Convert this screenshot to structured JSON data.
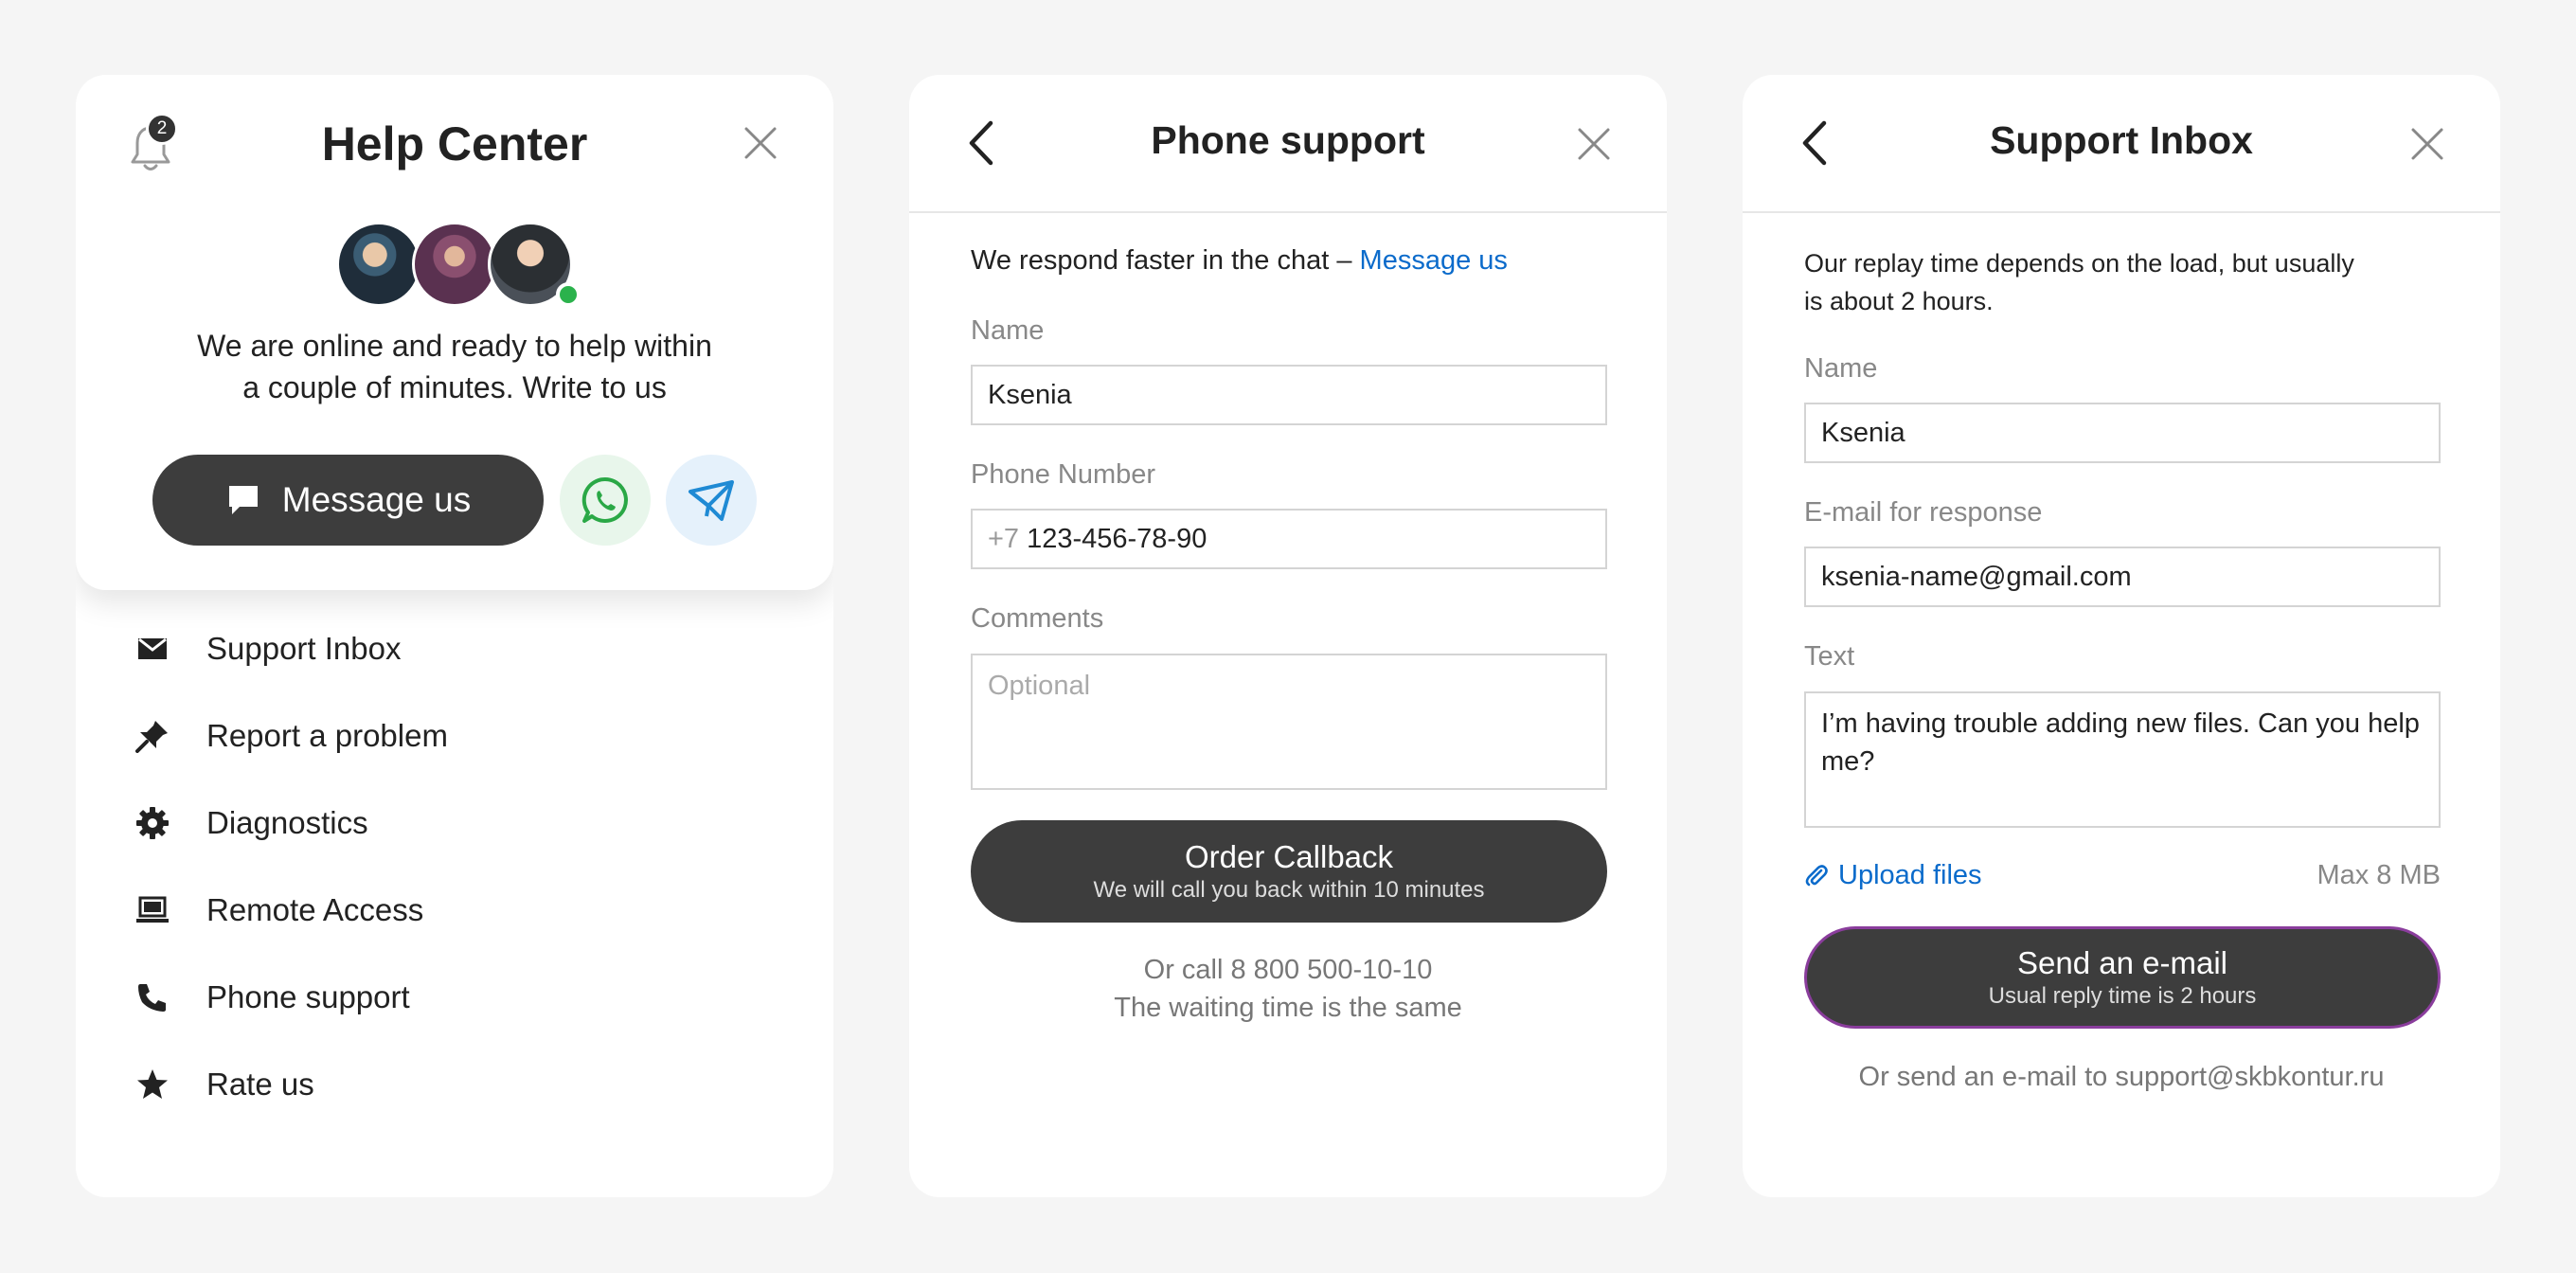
{
  "help_center": {
    "title": "Help Center",
    "notification_count": "2",
    "intro_line1": "We are online and ready to help within",
    "intro_line2": "a couple of minutes. Write to us",
    "message_button": "Message us",
    "menu": [
      {
        "label": "Support Inbox",
        "icon": "envelope-icon"
      },
      {
        "label": "Report a problem",
        "icon": "pin-icon"
      },
      {
        "label": "Diagnostics",
        "icon": "gear-icon"
      },
      {
        "label": "Remote Access",
        "icon": "laptop-icon"
      },
      {
        "label": "Phone support",
        "icon": "phone-icon"
      },
      {
        "label": "Rate us",
        "icon": "star-icon"
      }
    ]
  },
  "phone_support": {
    "title": "Phone support",
    "chat_hint": "We respond faster in the chat – ",
    "chat_link": "Message us",
    "name_label": "Name",
    "name_value": "Ksenia",
    "phone_label": "Phone Number",
    "phone_prefix": "+7",
    "phone_value": "123-456-78-90",
    "comments_label": "Comments",
    "comments_placeholder": "Optional",
    "button_main": "Order Callback",
    "button_sub": "We will call you back within 10 minutes",
    "call_line1": "Or call 8 800 500-10-10",
    "call_line2": "The waiting time is the same"
  },
  "support_inbox": {
    "title": "Support Inbox",
    "intro_line1": "Our replay time depends on the load, but usually",
    "intro_line2": "is about 2 hours.",
    "name_label": "Name",
    "name_value": "Ksenia",
    "email_label": "E-mail for response",
    "email_value": "ksenia-name@gmail.com",
    "text_label": "Text",
    "text_value": "I’m having trouble adding new files. Can you help me?",
    "upload_label": "Upload files",
    "max_size": "Max 8 MB",
    "button_main": "Send an e-mail",
    "button_sub": "Usual reply time is 2 hours",
    "email_note": "Or send an e-mail to support@skbkontur.ru"
  },
  "colors": {
    "accent_link": "#0b6bcb",
    "button_dark": "#3d3d3d",
    "online_green": "#2bb24c",
    "whatsapp_green": "#2aa846",
    "telegram_blue": "#1f8ad4",
    "focus_purple": "#8a3d9c"
  }
}
